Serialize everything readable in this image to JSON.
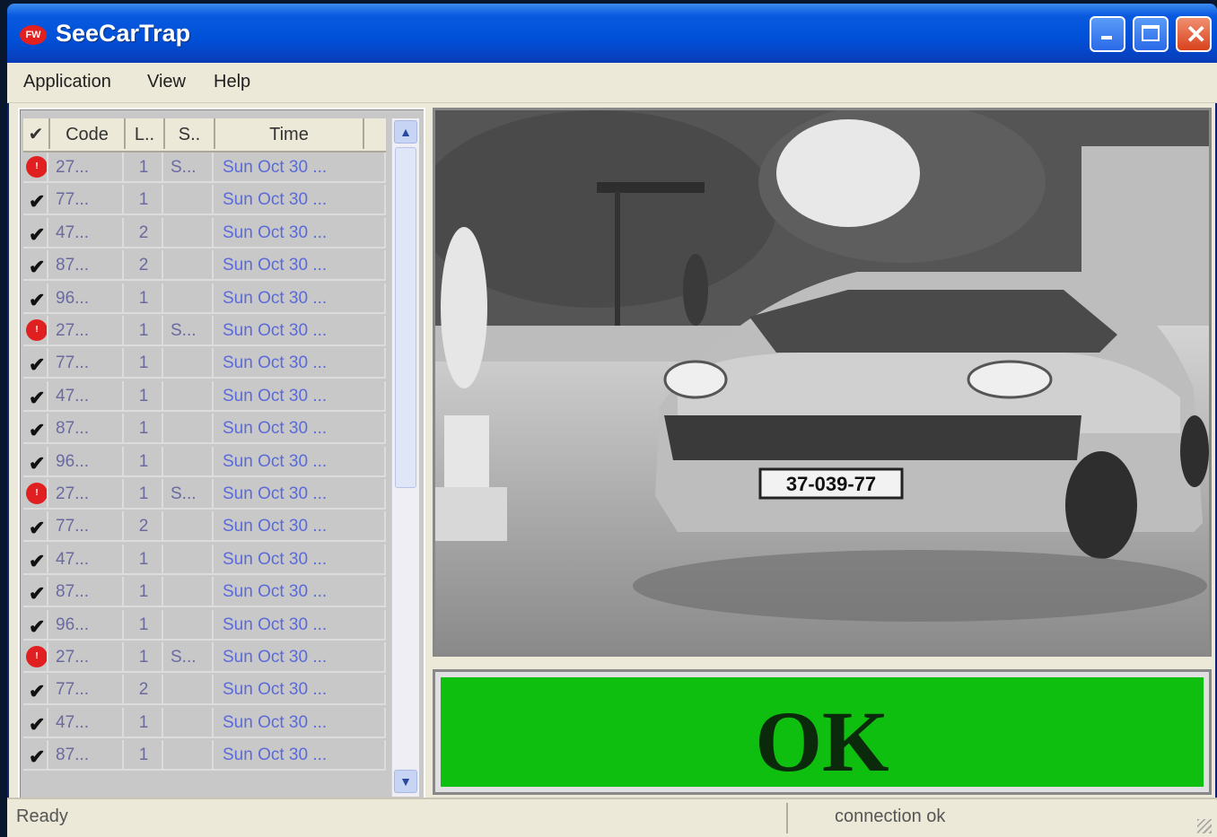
{
  "window": {
    "title": "SeeCarTrap",
    "app_icon_text": "FW"
  },
  "menu": [
    "Application",
    "View",
    "Help"
  ],
  "table": {
    "headers": {
      "check": "✔",
      "code": "Code",
      "l": "L..",
      "s": "S..",
      "time": "Time"
    },
    "rows": [
      {
        "status": "alert",
        "code": "27...",
        "l": "1",
        "s": "S...",
        "time": "Sun Oct 30 ..."
      },
      {
        "status": "ok",
        "code": "77...",
        "l": "1",
        "s": "",
        "time": "Sun Oct 30 ..."
      },
      {
        "status": "ok",
        "code": "47...",
        "l": "2",
        "s": "",
        "time": "Sun Oct 30 ..."
      },
      {
        "status": "ok",
        "code": "87...",
        "l": "2",
        "s": "",
        "time": "Sun Oct 30 ..."
      },
      {
        "status": "ok",
        "code": "96...",
        "l": "1",
        "s": "",
        "time": "Sun Oct 30 ..."
      },
      {
        "status": "alert",
        "code": "27...",
        "l": "1",
        "s": "S...",
        "time": "Sun Oct 30 ..."
      },
      {
        "status": "ok",
        "code": "77...",
        "l": "1",
        "s": "",
        "time": "Sun Oct 30 ..."
      },
      {
        "status": "ok",
        "code": "47...",
        "l": "1",
        "s": "",
        "time": "Sun Oct 30 ..."
      },
      {
        "status": "ok",
        "code": "87...",
        "l": "1",
        "s": "",
        "time": "Sun Oct 30 ..."
      },
      {
        "status": "ok",
        "code": "96...",
        "l": "1",
        "s": "",
        "time": "Sun Oct 30 ..."
      },
      {
        "status": "alert",
        "code": "27...",
        "l": "1",
        "s": "S...",
        "time": "Sun Oct 30 ..."
      },
      {
        "status": "ok",
        "code": "77...",
        "l": "2",
        "s": "",
        "time": "Sun Oct 30 ..."
      },
      {
        "status": "ok",
        "code": "47...",
        "l": "1",
        "s": "",
        "time": "Sun Oct 30 ..."
      },
      {
        "status": "ok",
        "code": "87...",
        "l": "1",
        "s": "",
        "time": "Sun Oct 30 ..."
      },
      {
        "status": "ok",
        "code": "96...",
        "l": "1",
        "s": "",
        "time": "Sun Oct 30 ..."
      },
      {
        "status": "alert",
        "code": "27...",
        "l": "1",
        "s": "S...",
        "time": "Sun Oct 30 ..."
      },
      {
        "status": "ok",
        "code": "77...",
        "l": "2",
        "s": "",
        "time": "Sun Oct 30 ..."
      },
      {
        "status": "ok",
        "code": "47...",
        "l": "1",
        "s": "",
        "time": "Sun Oct 30 ..."
      },
      {
        "status": "ok",
        "code": "87...",
        "l": "1",
        "s": "",
        "time": "Sun Oct 30 ..."
      }
    ]
  },
  "plate": "37-039-77",
  "status": {
    "big_text": "OK",
    "color": "#0fbf0f"
  },
  "statusbar": {
    "left": "Ready",
    "right": "connection ok"
  }
}
